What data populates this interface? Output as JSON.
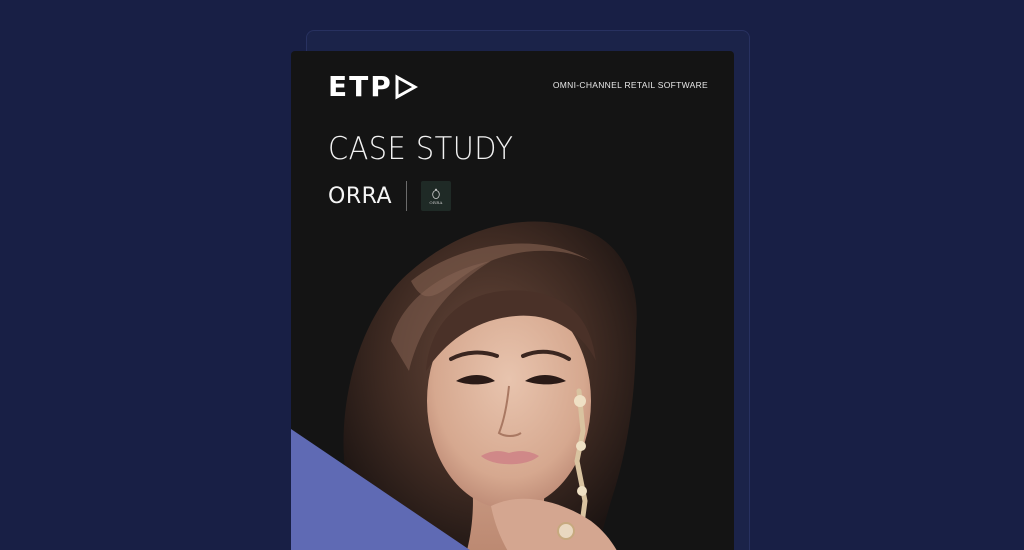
{
  "brand": {
    "logo_text": "ETP",
    "logo_icon": "play-triangle-icon",
    "tagline": "OMNI-CHANNEL RETAIL SOFTWARE"
  },
  "document": {
    "title": "CASE STUDY",
    "client_name": "ORRA",
    "client_logo_text": "ORRA",
    "client_logo_icon": "orra-ring-icon"
  },
  "colors": {
    "page_background": "#181f45",
    "card_background": "#141414",
    "accent": "#5f6ab4"
  }
}
